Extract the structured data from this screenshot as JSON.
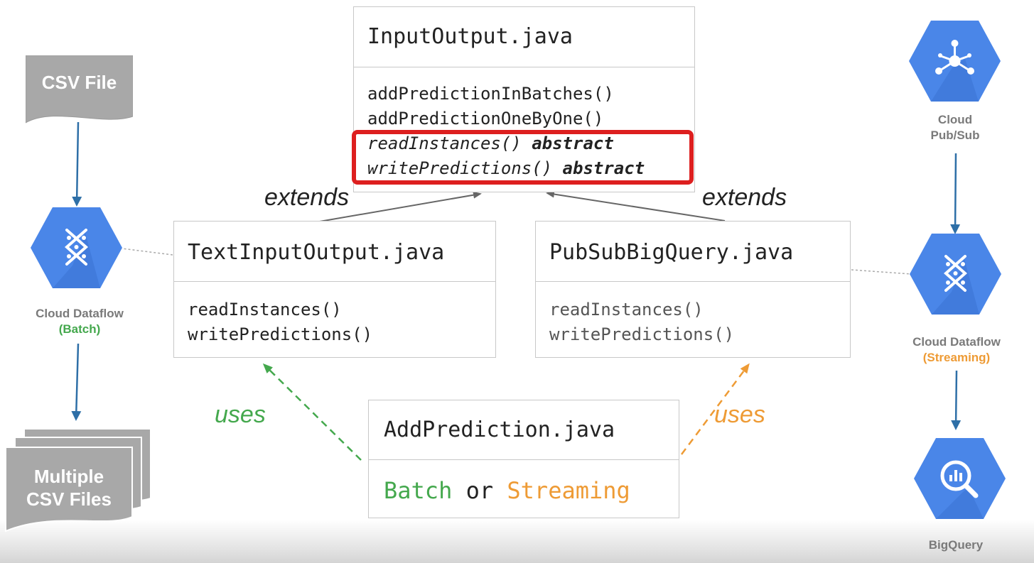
{
  "input_output": {
    "title": "InputOutput.java",
    "methods": [
      "addPredictionInBatches()",
      "addPredictionOneByOne()"
    ],
    "abstract_methods": [
      {
        "name": "readInstances()",
        "modifier": "abstract"
      },
      {
        "name": "writePredictions()",
        "modifier": "abstract"
      }
    ]
  },
  "text_input_output": {
    "title": "TextInputOutput.java",
    "methods": [
      "readInstances()",
      "writePredictions()"
    ]
  },
  "pubsub_bigquery": {
    "title": "PubSubBigQuery.java",
    "methods": [
      "readInstances()",
      "writePredictions()"
    ]
  },
  "add_prediction": {
    "title": "AddPrediction.java",
    "mode_batch": "Batch",
    "mode_or": "or",
    "mode_streaming": "Streaming"
  },
  "relations": {
    "extends_left": "extends",
    "extends_right": "extends",
    "uses_left": "uses",
    "uses_right": "uses"
  },
  "left_pipeline": {
    "csv_file": "CSV File",
    "dataflow_name": "Cloud Dataflow",
    "dataflow_mode": "(Batch)",
    "output_line1": "Multiple",
    "output_line2": "CSV Files"
  },
  "right_pipeline": {
    "pubsub_line1": "Cloud",
    "pubsub_line2": "Pub/Sub",
    "dataflow_name": "Cloud Dataflow",
    "dataflow_mode": "(Streaming)",
    "bigquery": "BigQuery"
  },
  "colors": {
    "gcp_blue": "#4a86e8",
    "gcp_blue_dark": "#3b73d1",
    "highlight_red": "#dd1f1f",
    "batch_green": "#44a84d",
    "streaming_orange": "#ee9b35",
    "document_gray": "#a8a8a8",
    "arrow_blue": "#2e6fa7"
  },
  "icons": [
    "document-icon",
    "dataflow-icon",
    "pubsub-icon",
    "bigquery-icon"
  ]
}
